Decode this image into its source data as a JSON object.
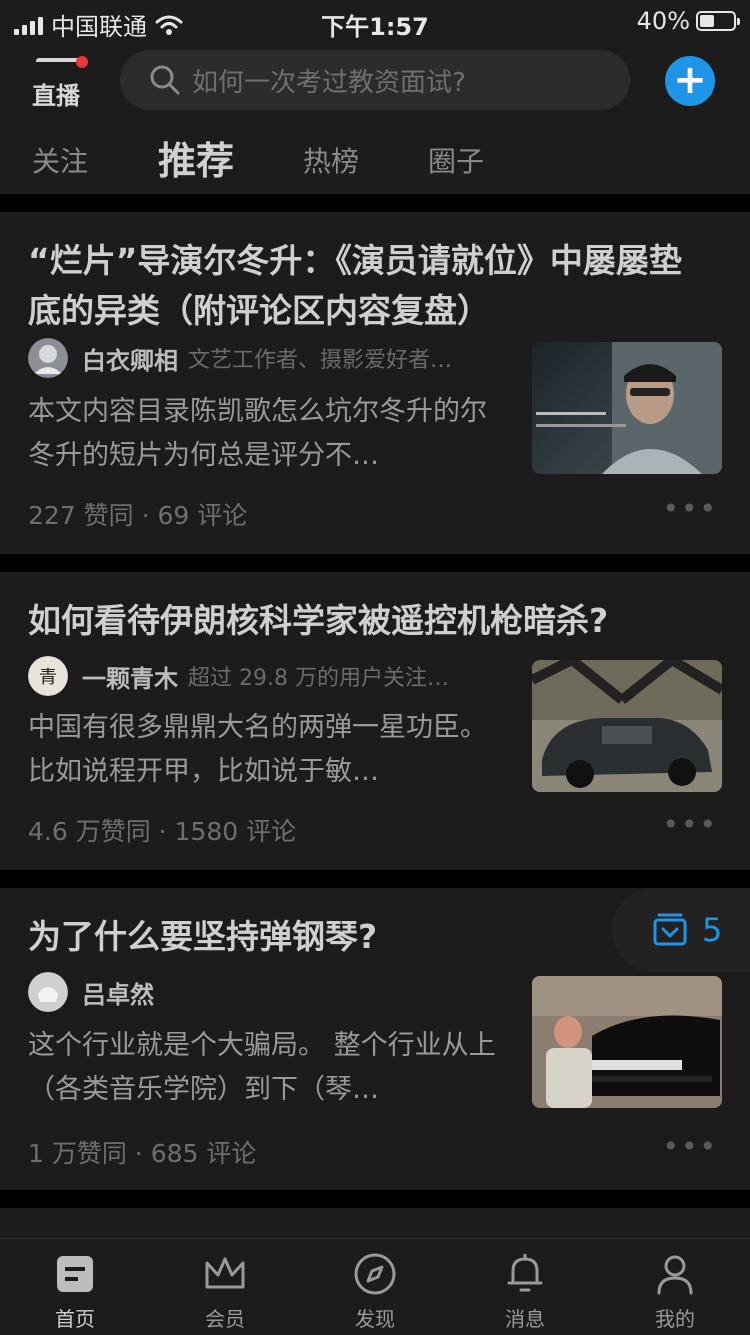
{
  "status_bar": {
    "carrier": "中国联通",
    "time": "下午1:57",
    "battery_percent": "40%"
  },
  "header": {
    "live_label": "直播",
    "search_placeholder": "如何一次考过教资面试?",
    "tabs": [
      {
        "label": "关注",
        "active": false
      },
      {
        "label": "推荐",
        "active": true
      },
      {
        "label": "热榜",
        "active": false
      },
      {
        "label": "圈子",
        "active": false
      }
    ]
  },
  "feed": [
    {
      "title": "“烂片”导演尔冬升：《演员请就位》中屡屡垫底的异类（附评论区内容复盘）",
      "author": "白衣卿相",
      "author_desc": "文艺工作者、摄影爱好者…",
      "excerpt": "本文内容目录陈凯歌怎么坑尔冬升的尔冬升的短片为何总是评分不…",
      "meta": "227 赞同 · 69 评论"
    },
    {
      "title": "如何看待伊朗核科学家被遥控机枪暗杀?",
      "author": "一颗青木",
      "author_desc": "超过 29.8 万的用户关注…",
      "excerpt": "中国有很多鼎鼎大名的两弹一星功臣。 比如说程开甲，比如说于敏…",
      "meta": "4.6 万赞同 · 1580 评论"
    },
    {
      "title": "为了什么要坚持弹钢琴?",
      "author": "吕卓然",
      "author_desc": "",
      "excerpt": "这个行业就是个大骗局。 整个行业从上（各类音乐学院）到下（琴…",
      "meta": "1 万赞同 · 685 评论"
    }
  ],
  "float_badge": {
    "count": "5"
  },
  "tab_bar": [
    {
      "label": "首页",
      "icon": "home-icon",
      "active": true
    },
    {
      "label": "会员",
      "icon": "crown-icon",
      "active": false
    },
    {
      "label": "发现",
      "icon": "compass-icon",
      "active": false
    },
    {
      "label": "消息",
      "icon": "bell-icon",
      "active": false
    },
    {
      "label": "我的",
      "icon": "profile-icon",
      "active": false
    }
  ],
  "colors": {
    "background": "#000000",
    "surface": "#1c1c1c",
    "accent": "#1f95e8",
    "live_dot": "#e53935"
  }
}
